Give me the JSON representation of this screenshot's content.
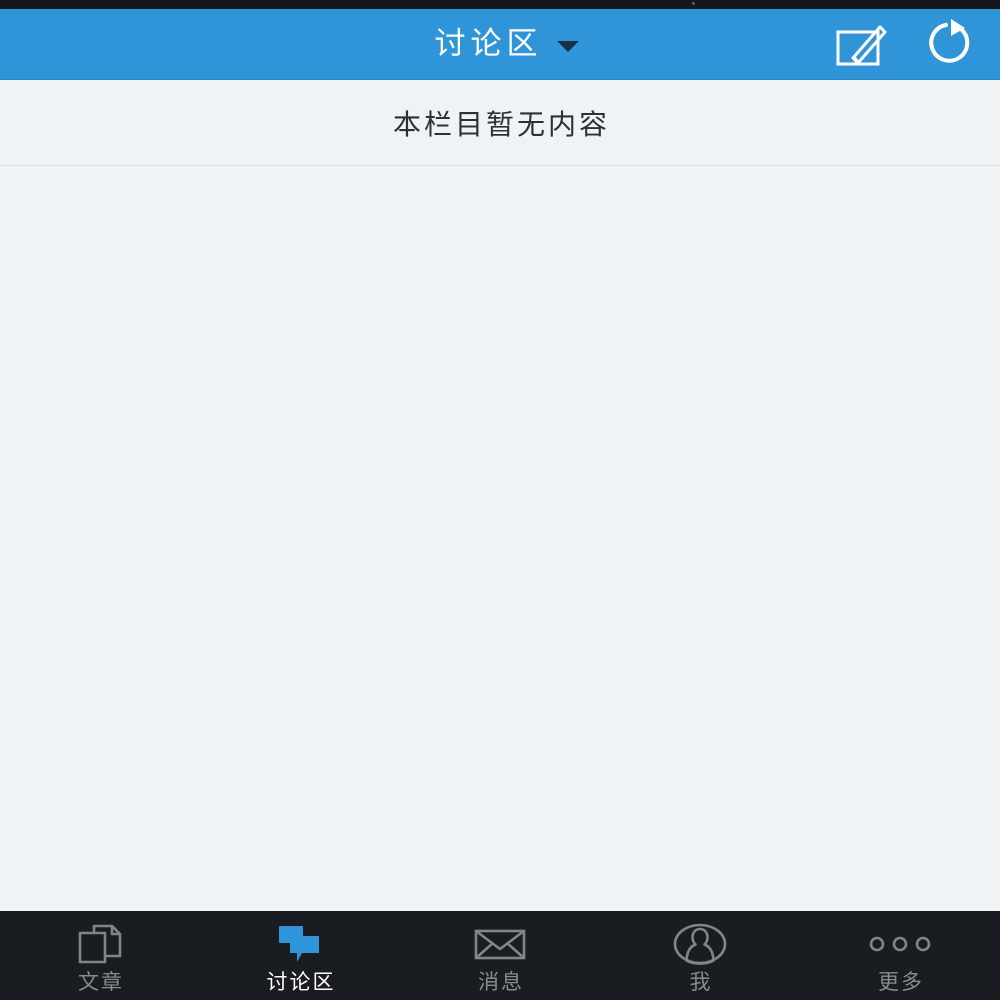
{
  "colors": {
    "header_blue": "#2f95d8",
    "accent_blue": "#2f95d8",
    "tabbar_dark": "#191d21",
    "status_strip": "#14181c",
    "content_bg": "#eff3f6",
    "inactive_label": "#868b91",
    "active_label": "#ffffff",
    "divider": "#dcdfe4"
  },
  "header": {
    "title": "讨论区",
    "dropdown_icon": "chevron-down-icon",
    "actions": [
      {
        "name": "compose-button",
        "icon": "compose-icon"
      },
      {
        "name": "refresh-button",
        "icon": "refresh-icon"
      }
    ]
  },
  "main": {
    "empty_state_text": "本栏目暂无内容"
  },
  "tabbar": {
    "items": [
      {
        "label": "文章",
        "icon": "documents-icon",
        "active": false
      },
      {
        "label": "讨论区",
        "icon": "chat-bubbles-icon",
        "active": true
      },
      {
        "label": "消息",
        "icon": "envelope-icon",
        "active": false
      },
      {
        "label": "我",
        "icon": "person-icon",
        "active": false
      },
      {
        "label": "更多",
        "icon": "more-dots-icon",
        "active": false
      }
    ]
  }
}
